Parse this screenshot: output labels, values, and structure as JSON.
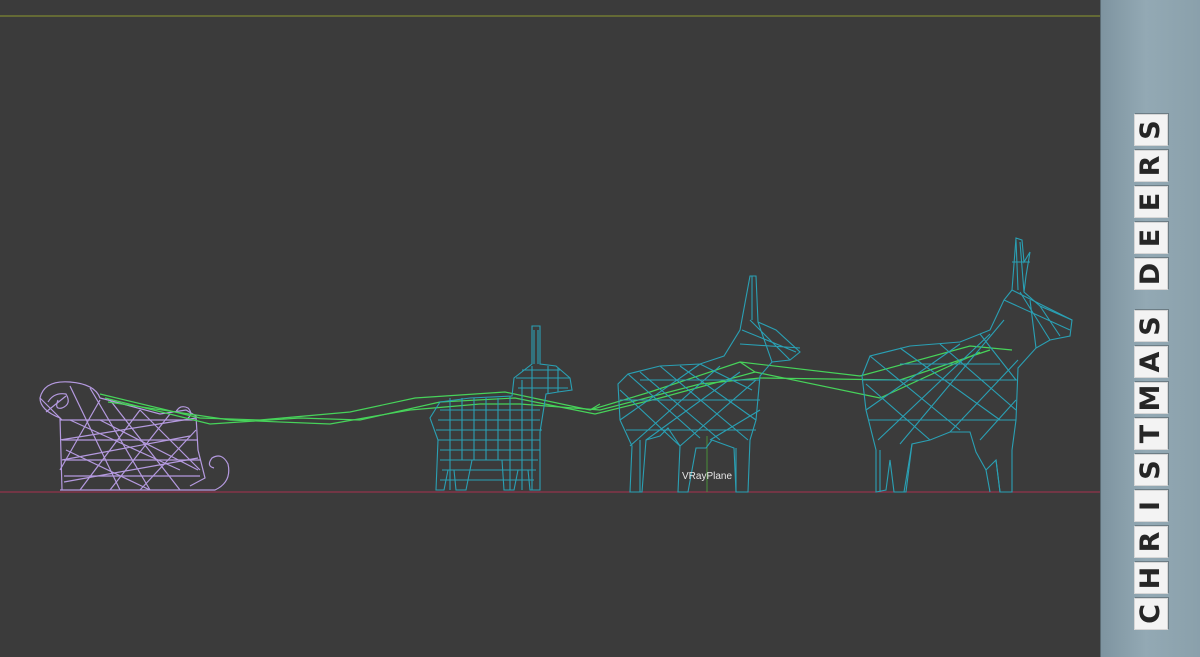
{
  "viewport": {
    "object_label": "VRayPlane",
    "colors": {
      "background": "#3b3b3b",
      "horizon_line": "#8c9a2f",
      "ground_line": "#a8324f",
      "sleigh_wire": "#b59ae0",
      "deer_wire": "#2aa0b4",
      "reins_wire": "#47d35a",
      "pivot_axis": "#4a8f3a"
    },
    "objects": [
      "sleigh-icon",
      "deer-small-icon",
      "deer-medium-icon",
      "deer-large-icon",
      "reins-icon"
    ]
  },
  "banner": {
    "title": "CHRISTMAS DEERS",
    "colors": {
      "background": "#8ea4af",
      "tile": "#f3f3f3",
      "letter": "#262626"
    }
  }
}
